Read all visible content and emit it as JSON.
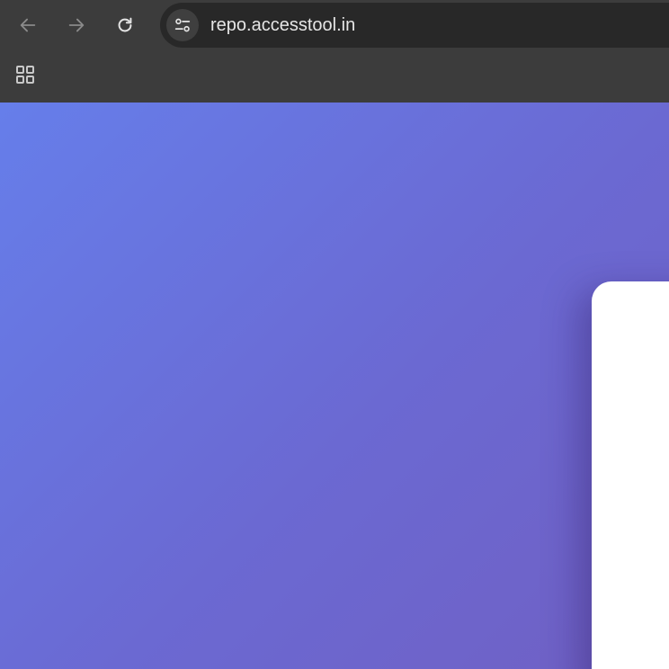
{
  "browser": {
    "address_bar": {
      "url": "repo.accesstool.in"
    },
    "icons": {
      "back": "arrow-left-icon",
      "forward": "arrow-right-icon",
      "reload": "reload-icon",
      "site_info": "tune-icon",
      "apps": "apps-grid-icon"
    }
  },
  "colors": {
    "toolbar_bg": "#3c3c3c",
    "omnibox_bg": "#282828",
    "gradient_start": "#667eea",
    "gradient_end": "#7060c4",
    "card_bg": "#ffffff"
  }
}
